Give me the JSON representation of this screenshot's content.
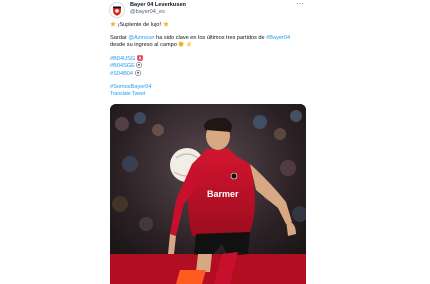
{
  "tweet": {
    "display_name": "Bayer 04 Leverkusen",
    "handle": "@bayer04_es",
    "line1": "¡Suplente de lujo!",
    "line2_prefix": "Sardar ",
    "mention": "@Azmoun",
    "line2_mid": " ha sido clave en los últimos tres partidos de ",
    "hashtag_main": "#Bayer04",
    "line3": "desde su ingreso al campo",
    "hashtags": [
      "#B04USG",
      "#B04SGE",
      "#S04B04"
    ],
    "hashtag_final": "#SomosBayer04",
    "translate": "Translate Tweet"
  },
  "photo": {
    "jersey_text": "Barmer"
  },
  "icons": {
    "avatar": "bayer04-crest-icon",
    "more": "more-options-icon",
    "star": "star-emoji-icon"
  },
  "colors": {
    "link": "#1d9bf0",
    "secondary_text": "#536471",
    "jersey_red": "#c8102e"
  }
}
